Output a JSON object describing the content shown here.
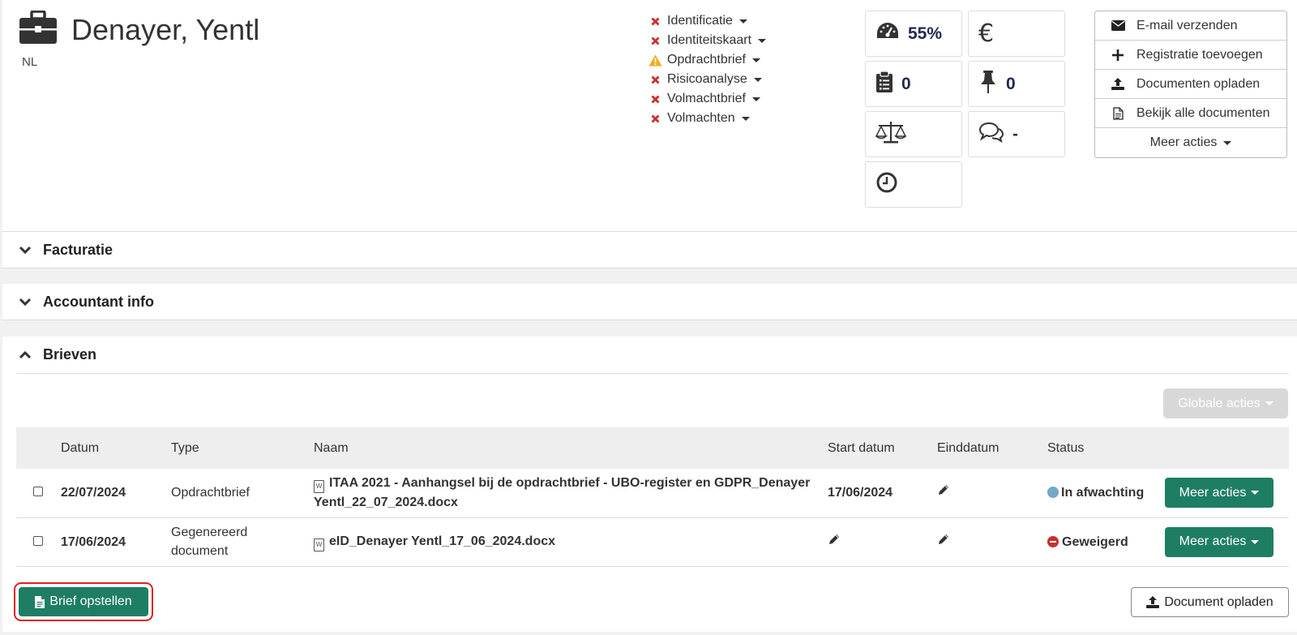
{
  "client": {
    "name": "Denayer, Yentl",
    "language": "NL"
  },
  "checklist": [
    {
      "label": "Identificatie",
      "state": "missing"
    },
    {
      "label": "Identiteitskaart",
      "state": "missing"
    },
    {
      "label": "Opdrachtbrief",
      "state": "warning"
    },
    {
      "label": "Risicoanalyse",
      "state": "missing"
    },
    {
      "label": "Volmachtbrief",
      "state": "missing"
    },
    {
      "label": "Volmachten",
      "state": "missing"
    }
  ],
  "tiles": {
    "progress": "55%",
    "euro": "",
    "tasks": "0",
    "pins": "0",
    "legal": "",
    "comments": "-",
    "time": ""
  },
  "actions": [
    {
      "label": "E-mail verzenden",
      "icon": "envelope-icon"
    },
    {
      "label": "Registratie toevoegen",
      "icon": "plus-icon"
    },
    {
      "label": "Documenten opladen",
      "icon": "upload-icon"
    },
    {
      "label": "Bekijk alle documenten",
      "icon": "document-icon"
    },
    {
      "label": "Meer acties",
      "icon": "caret-down-icon"
    }
  ],
  "sections": {
    "facturatie": "Facturatie",
    "accountant": "Accountant info",
    "brieven": "Brieven"
  },
  "brieven": {
    "global_actions": "Globale acties",
    "columns": [
      "Datum",
      "Type",
      "Naam",
      "Start datum",
      "Einddatum",
      "Status"
    ],
    "rows": [
      {
        "datum": "22/07/2024",
        "type": "Opdrachtbrief",
        "naam": "ITAA 2021 - Aanhangsel bij de opdrachtbrief - UBO-register en GDPR_Denayer Yentl_22_07_2024.docx",
        "start": "17/06/2024",
        "status": "In afwachting",
        "action": "Meer acties"
      },
      {
        "datum": "17/06/2024",
        "type": "Gegenereerd document",
        "naam": "eID_Denayer Yentl_17_06_2024.docx",
        "start": "",
        "status": "Geweigerd",
        "action": "Meer acties"
      }
    ],
    "create_button": "Brief opstellen",
    "upload_button": "Document opladen"
  },
  "colors": {
    "primary": "#1e7e64",
    "danger": "#c9302c",
    "warning": "#f0ad1b",
    "pending": "#72a8c9",
    "highlight": "#e02020"
  }
}
